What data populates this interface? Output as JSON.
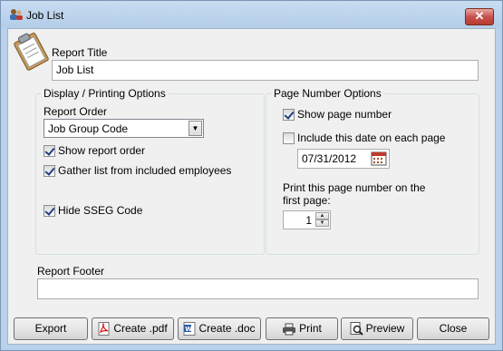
{
  "window": {
    "title": "Job List",
    "close_glyph": "✕"
  },
  "report_title": {
    "label": "Report Title",
    "value": "Job List"
  },
  "display_options": {
    "group_title": "Display / Printing Options",
    "report_order_label": "Report Order",
    "report_order_value": "Job Group Code",
    "show_report_order": {
      "label": "Show report order",
      "checked": true
    },
    "gather_list": {
      "label": "Gather list from included employees",
      "checked": true
    },
    "hide_sseg": {
      "label": "Hide SSEG Code",
      "checked": true
    }
  },
  "page_number_options": {
    "group_title": "Page Number Options",
    "show_page_number": {
      "label": "Show page number",
      "checked": true
    },
    "include_date": {
      "label": "Include this date on each page",
      "checked": false
    },
    "date_value": "07/31/2012",
    "first_page_label_line1": "Print this page number on the",
    "first_page_label_line2": "first page:",
    "first_page_value": "1"
  },
  "report_footer": {
    "label": "Report Footer",
    "value": ""
  },
  "buttons": {
    "export": "Export",
    "create_pdf": "Create .pdf",
    "create_doc": "Create .doc",
    "print": "Print",
    "preview": "Preview",
    "close": "Close"
  }
}
